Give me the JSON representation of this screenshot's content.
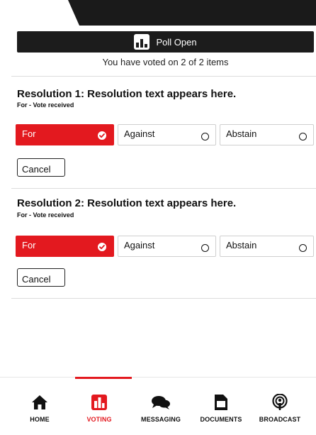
{
  "poll": {
    "status": "Poll Open",
    "voted_summary": "You have voted on 2 of 2 items"
  },
  "resolutions": [
    {
      "title": "Resolution 1: Resolution text appears here.",
      "status": "For - Vote received",
      "options": [
        "For",
        "Against",
        "Abstain"
      ],
      "selected": "For",
      "cancel_label": "Cancel"
    },
    {
      "title": "Resolution 2: Resolution text appears here.",
      "status": "For - Vote received",
      "options": [
        "For",
        "Against",
        "Abstain"
      ],
      "selected": "For",
      "cancel_label": "Cancel"
    }
  ],
  "nav": {
    "active": "VOTING",
    "items": [
      {
        "label": "HOME",
        "icon": "home-icon"
      },
      {
        "label": "VOTING",
        "icon": "bar-chart-icon"
      },
      {
        "label": "MESSAGING",
        "icon": "chat-bubbles-icon"
      },
      {
        "label": "DOCUMENTS",
        "icon": "document-icon"
      },
      {
        "label": "BROADCAST",
        "icon": "podcast-icon"
      }
    ]
  },
  "colors": {
    "accent": "#e3191f",
    "dark": "#1c1c1c"
  }
}
